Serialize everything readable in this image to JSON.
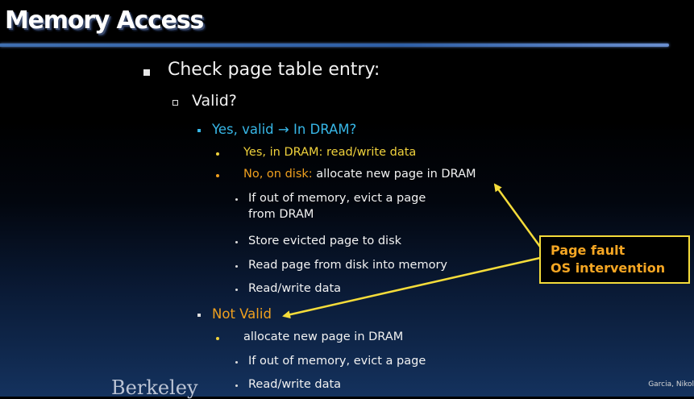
{
  "title": "Memory Access",
  "bullets": {
    "check": "Check page table entry:",
    "valid": "Valid?",
    "yes_valid_prefix": "Yes, valid ",
    "yes_valid_arrow": "→",
    "yes_valid_suffix": " In DRAM?",
    "yes_in_dram": "Yes, in DRAM: read/write data",
    "no_on_disk_prefix": "No, on disk:",
    "no_on_disk_rest": " allocate new page in DRAM",
    "evict_line1": "If out of memory, evict a page",
    "evict_line2": "from DRAM",
    "store_evicted": "Store evicted page to disk",
    "read_page": "Read page from disk into memory",
    "read_write_1": "Read/write data",
    "not_valid": "Not Valid",
    "allocate_new": "allocate new page in DRAM",
    "evict_short": "If out of memory, evict a page",
    "read_write_2": "Read/write data"
  },
  "callout": {
    "line1": "Page fault",
    "line2": "OS intervention"
  },
  "footer": {
    "left": "Berkeley",
    "right": "Garcia, Nikol"
  },
  "colors": {
    "title": "#ffffff",
    "cyan": "#37b6e6",
    "gold": "#f0d23c",
    "orange": "#f0a01e",
    "callout_border": "#f5dc3a",
    "callout_text": "#f5a623"
  }
}
